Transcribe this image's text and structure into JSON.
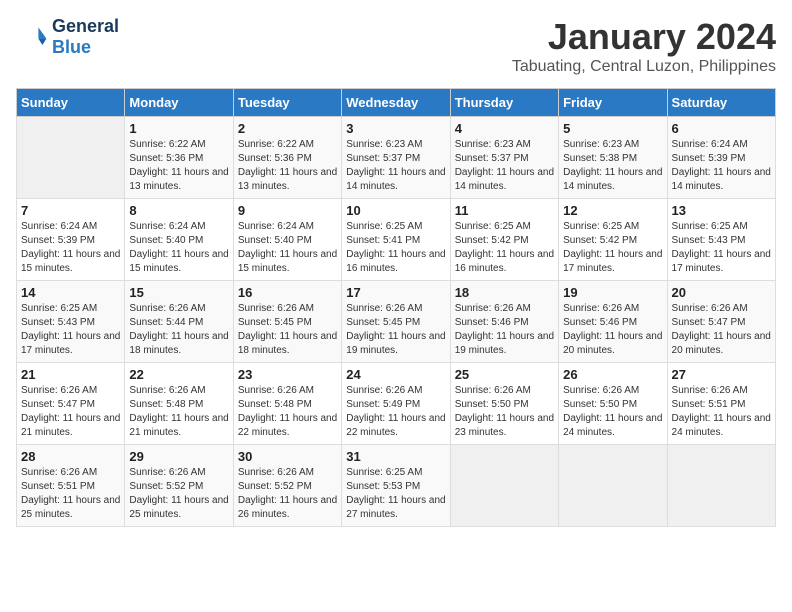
{
  "logo": {
    "line1": "General",
    "line2": "Blue"
  },
  "title": "January 2024",
  "subtitle": "Tabuating, Central Luzon, Philippines",
  "weekdays": [
    "Sunday",
    "Monday",
    "Tuesday",
    "Wednesday",
    "Thursday",
    "Friday",
    "Saturday"
  ],
  "weeks": [
    [
      {
        "day": "",
        "sunrise": "",
        "sunset": "",
        "daylight": ""
      },
      {
        "day": "1",
        "sunrise": "Sunrise: 6:22 AM",
        "sunset": "Sunset: 5:36 PM",
        "daylight": "Daylight: 11 hours and 13 minutes."
      },
      {
        "day": "2",
        "sunrise": "Sunrise: 6:22 AM",
        "sunset": "Sunset: 5:36 PM",
        "daylight": "Daylight: 11 hours and 13 minutes."
      },
      {
        "day": "3",
        "sunrise": "Sunrise: 6:23 AM",
        "sunset": "Sunset: 5:37 PM",
        "daylight": "Daylight: 11 hours and 14 minutes."
      },
      {
        "day": "4",
        "sunrise": "Sunrise: 6:23 AM",
        "sunset": "Sunset: 5:37 PM",
        "daylight": "Daylight: 11 hours and 14 minutes."
      },
      {
        "day": "5",
        "sunrise": "Sunrise: 6:23 AM",
        "sunset": "Sunset: 5:38 PM",
        "daylight": "Daylight: 11 hours and 14 minutes."
      },
      {
        "day": "6",
        "sunrise": "Sunrise: 6:24 AM",
        "sunset": "Sunset: 5:39 PM",
        "daylight": "Daylight: 11 hours and 14 minutes."
      }
    ],
    [
      {
        "day": "7",
        "sunrise": "Sunrise: 6:24 AM",
        "sunset": "Sunset: 5:39 PM",
        "daylight": "Daylight: 11 hours and 15 minutes."
      },
      {
        "day": "8",
        "sunrise": "Sunrise: 6:24 AM",
        "sunset": "Sunset: 5:40 PM",
        "daylight": "Daylight: 11 hours and 15 minutes."
      },
      {
        "day": "9",
        "sunrise": "Sunrise: 6:24 AM",
        "sunset": "Sunset: 5:40 PM",
        "daylight": "Daylight: 11 hours and 15 minutes."
      },
      {
        "day": "10",
        "sunrise": "Sunrise: 6:25 AM",
        "sunset": "Sunset: 5:41 PM",
        "daylight": "Daylight: 11 hours and 16 minutes."
      },
      {
        "day": "11",
        "sunrise": "Sunrise: 6:25 AM",
        "sunset": "Sunset: 5:42 PM",
        "daylight": "Daylight: 11 hours and 16 minutes."
      },
      {
        "day": "12",
        "sunrise": "Sunrise: 6:25 AM",
        "sunset": "Sunset: 5:42 PM",
        "daylight": "Daylight: 11 hours and 17 minutes."
      },
      {
        "day": "13",
        "sunrise": "Sunrise: 6:25 AM",
        "sunset": "Sunset: 5:43 PM",
        "daylight": "Daylight: 11 hours and 17 minutes."
      }
    ],
    [
      {
        "day": "14",
        "sunrise": "Sunrise: 6:25 AM",
        "sunset": "Sunset: 5:43 PM",
        "daylight": "Daylight: 11 hours and 17 minutes."
      },
      {
        "day": "15",
        "sunrise": "Sunrise: 6:26 AM",
        "sunset": "Sunset: 5:44 PM",
        "daylight": "Daylight: 11 hours and 18 minutes."
      },
      {
        "day": "16",
        "sunrise": "Sunrise: 6:26 AM",
        "sunset": "Sunset: 5:45 PM",
        "daylight": "Daylight: 11 hours and 18 minutes."
      },
      {
        "day": "17",
        "sunrise": "Sunrise: 6:26 AM",
        "sunset": "Sunset: 5:45 PM",
        "daylight": "Daylight: 11 hours and 19 minutes."
      },
      {
        "day": "18",
        "sunrise": "Sunrise: 6:26 AM",
        "sunset": "Sunset: 5:46 PM",
        "daylight": "Daylight: 11 hours and 19 minutes."
      },
      {
        "day": "19",
        "sunrise": "Sunrise: 6:26 AM",
        "sunset": "Sunset: 5:46 PM",
        "daylight": "Daylight: 11 hours and 20 minutes."
      },
      {
        "day": "20",
        "sunrise": "Sunrise: 6:26 AM",
        "sunset": "Sunset: 5:47 PM",
        "daylight": "Daylight: 11 hours and 20 minutes."
      }
    ],
    [
      {
        "day": "21",
        "sunrise": "Sunrise: 6:26 AM",
        "sunset": "Sunset: 5:47 PM",
        "daylight": "Daylight: 11 hours and 21 minutes."
      },
      {
        "day": "22",
        "sunrise": "Sunrise: 6:26 AM",
        "sunset": "Sunset: 5:48 PM",
        "daylight": "Daylight: 11 hours and 21 minutes."
      },
      {
        "day": "23",
        "sunrise": "Sunrise: 6:26 AM",
        "sunset": "Sunset: 5:48 PM",
        "daylight": "Daylight: 11 hours and 22 minutes."
      },
      {
        "day": "24",
        "sunrise": "Sunrise: 6:26 AM",
        "sunset": "Sunset: 5:49 PM",
        "daylight": "Daylight: 11 hours and 22 minutes."
      },
      {
        "day": "25",
        "sunrise": "Sunrise: 6:26 AM",
        "sunset": "Sunset: 5:50 PM",
        "daylight": "Daylight: 11 hours and 23 minutes."
      },
      {
        "day": "26",
        "sunrise": "Sunrise: 6:26 AM",
        "sunset": "Sunset: 5:50 PM",
        "daylight": "Daylight: 11 hours and 24 minutes."
      },
      {
        "day": "27",
        "sunrise": "Sunrise: 6:26 AM",
        "sunset": "Sunset: 5:51 PM",
        "daylight": "Daylight: 11 hours and 24 minutes."
      }
    ],
    [
      {
        "day": "28",
        "sunrise": "Sunrise: 6:26 AM",
        "sunset": "Sunset: 5:51 PM",
        "daylight": "Daylight: 11 hours and 25 minutes."
      },
      {
        "day": "29",
        "sunrise": "Sunrise: 6:26 AM",
        "sunset": "Sunset: 5:52 PM",
        "daylight": "Daylight: 11 hours and 25 minutes."
      },
      {
        "day": "30",
        "sunrise": "Sunrise: 6:26 AM",
        "sunset": "Sunset: 5:52 PM",
        "daylight": "Daylight: 11 hours and 26 minutes."
      },
      {
        "day": "31",
        "sunrise": "Sunrise: 6:25 AM",
        "sunset": "Sunset: 5:53 PM",
        "daylight": "Daylight: 11 hours and 27 minutes."
      },
      {
        "day": "",
        "sunrise": "",
        "sunset": "",
        "daylight": ""
      },
      {
        "day": "",
        "sunrise": "",
        "sunset": "",
        "daylight": ""
      },
      {
        "day": "",
        "sunrise": "",
        "sunset": "",
        "daylight": ""
      }
    ]
  ]
}
